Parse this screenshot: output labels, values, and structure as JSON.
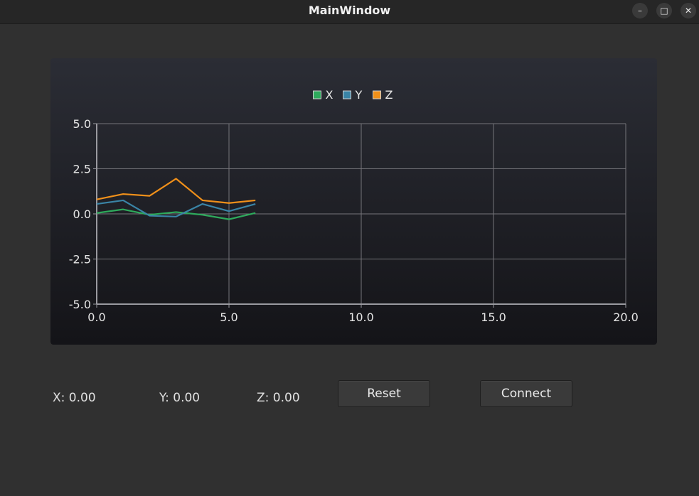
{
  "window": {
    "title": "MainWindow",
    "controls": {
      "minimize": "–",
      "maximize": "□",
      "close": "✕"
    }
  },
  "readouts": {
    "x": "X: 0.00",
    "y": "Y: 0.00",
    "z": "Z: 0.00"
  },
  "buttons": {
    "reset": "Reset",
    "connect": "Connect"
  },
  "chart_data": {
    "type": "line",
    "title": "",
    "xlabel": "",
    "ylabel": "",
    "xlim": [
      0,
      20
    ],
    "ylim": [
      -5,
      5
    ],
    "xticks": [
      "0.0",
      "5.0",
      "10.0",
      "15.0",
      "20.0"
    ],
    "yticks": [
      "5.0",
      "2.5",
      "0.0",
      "-2.5",
      "-5.0"
    ],
    "grid": true,
    "legend": "top-center",
    "x": [
      0,
      1,
      2,
      3,
      4,
      5,
      6
    ],
    "series": [
      {
        "name": "X",
        "color": "#2eaa5c",
        "values": [
          0.05,
          0.25,
          -0.05,
          0.1,
          -0.05,
          -0.3,
          0.05
        ]
      },
      {
        "name": "Y",
        "color": "#3a84a6",
        "values": [
          0.55,
          0.75,
          -0.1,
          -0.15,
          0.55,
          0.15,
          0.55
        ]
      },
      {
        "name": "Z",
        "color": "#f0901a",
        "values": [
          0.8,
          1.1,
          1.0,
          1.95,
          0.75,
          0.6,
          0.75
        ]
      }
    ]
  }
}
